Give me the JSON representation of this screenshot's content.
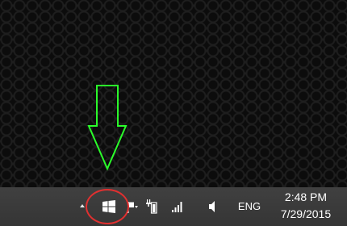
{
  "annotation": {
    "arrow_color": "#2aff2a",
    "circle_color": "#e03030"
  },
  "taskbar": {
    "tray_icons": [
      {
        "name": "show-hidden-icons-chevron-icon"
      },
      {
        "name": "windows-logo-icon"
      },
      {
        "name": "action-center-flag-icon"
      },
      {
        "name": "battery-icon"
      },
      {
        "name": "network-signal-icon"
      },
      {
        "name": "volume-icon"
      }
    ],
    "language": "ENG",
    "clock": {
      "time": "2:48 PM",
      "date": "7/29/2015"
    }
  }
}
